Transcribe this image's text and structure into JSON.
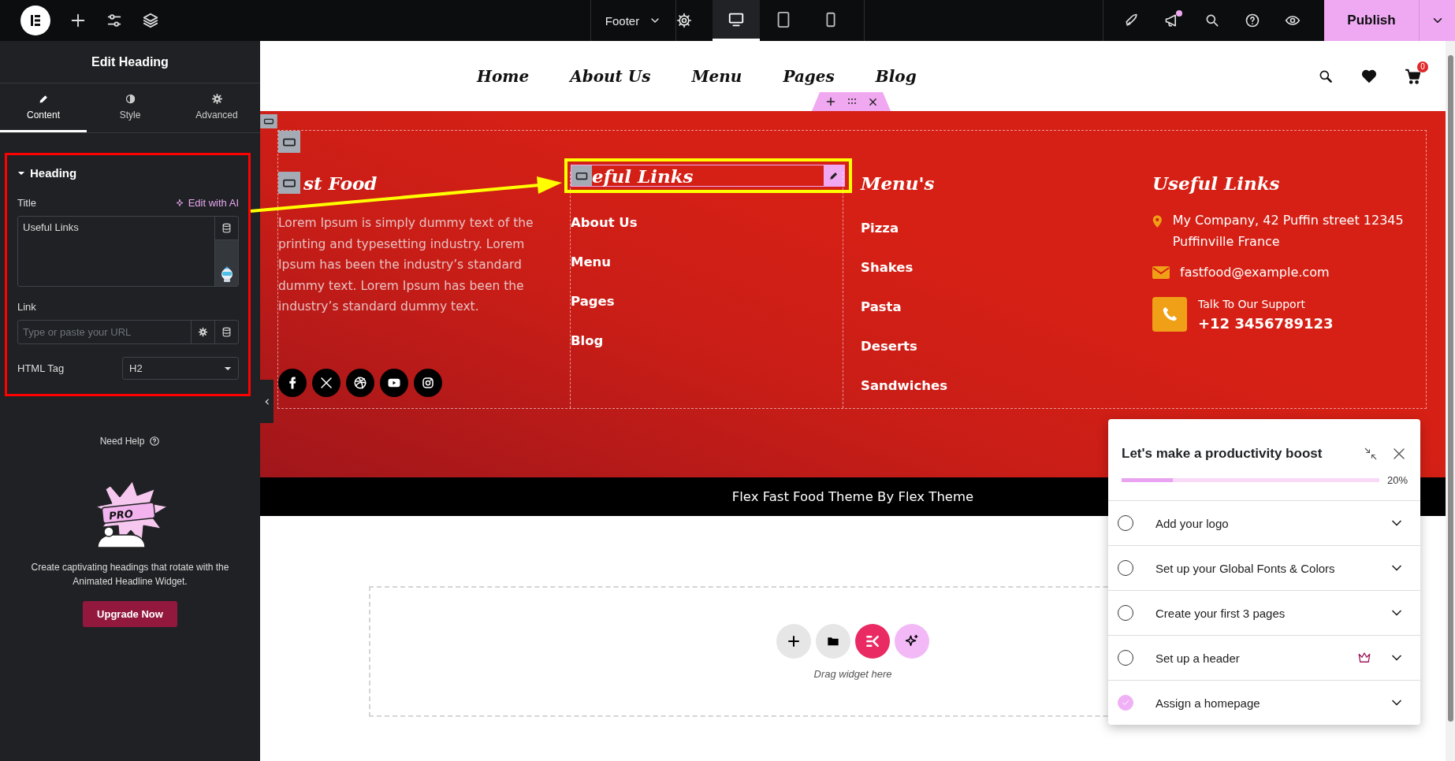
{
  "top_bar": {
    "document": "Footer",
    "devices": [
      {
        "selected": true
      },
      {
        "selected": false
      },
      {
        "selected": false
      }
    ],
    "publish": "Publish"
  },
  "panel": {
    "title": "Edit Heading",
    "tabs": [
      {
        "label": "Content",
        "selected": true
      },
      {
        "label": "Style",
        "selected": false
      },
      {
        "label": "Advanced",
        "selected": false
      }
    ],
    "section": {
      "label": "Heading",
      "expanded": true,
      "title_label": "Title",
      "ai_link": "Edit with AI",
      "title_value": "Useful Links",
      "link_label": "Link",
      "link_placeholder": "Type or paste your URL",
      "tag_label": "HTML Tag",
      "tag_value": "H2"
    },
    "help": "Need Help",
    "promo_badge": "PRO",
    "promo_text": "Create captivating headings that rotate with the Animated Headline Widget.",
    "upgrade": "Upgrade Now"
  },
  "site": {
    "nav": [
      "Home",
      "About Us",
      "Menu",
      "Pages",
      "Blog"
    ],
    "cart_count": "0",
    "footer": {
      "about": {
        "heading": "st Food",
        "text": "Lorem Ipsum is simply dummy text of the printing and typesetting industry. Lorem Ipsum has been the industry’s standard dummy text. Lorem Ipsum has been the industry’s standard dummy text."
      },
      "links": {
        "heading": "eful Links",
        "items": [
          "About Us",
          "Menu",
          "Pages",
          "Blog"
        ]
      },
      "menus": {
        "heading": "Menu's",
        "items": [
          "Pizza",
          "Shakes",
          "Pasta",
          "Deserts",
          "Sandwiches"
        ]
      },
      "contact": {
        "heading": "Useful Links",
        "address": "My Company, 42 Puffin street 12345 Puffinville France",
        "email": "fastfood@example.com",
        "support_label": "Talk To Our Support",
        "phone": "+12 3456789123"
      }
    },
    "copyright": "Flex Fast Food Theme By Flex Theme",
    "dropzone": "Drag widget here"
  },
  "checklist": {
    "title": "Let's make a productivity boost",
    "level": 0.2,
    "percent": "20%",
    "items": [
      {
        "label": "Add your logo",
        "checked": false,
        "pro": false
      },
      {
        "label": "Set up your Global Fonts & Colors",
        "checked": false,
        "pro": false
      },
      {
        "label": "Create your first 3 pages",
        "checked": false,
        "pro": false
      },
      {
        "label": "Set up a header",
        "checked": false,
        "pro": true
      },
      {
        "label": "Assign a homepage",
        "checked": true,
        "pro": false
      }
    ]
  }
}
